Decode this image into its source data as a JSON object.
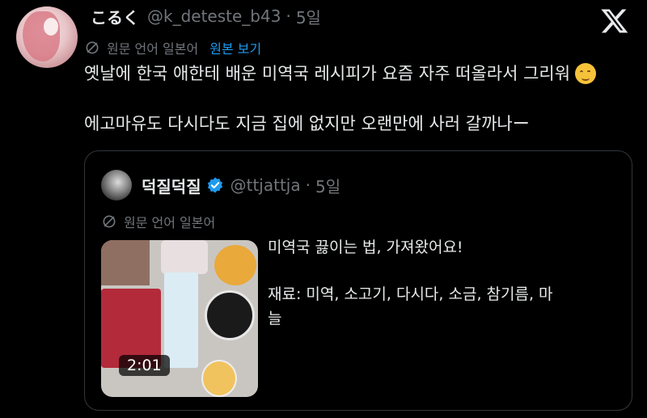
{
  "tweet": {
    "display_name": "こるく",
    "handle": "@k_deteste_b43",
    "separator": "·",
    "time": "5일",
    "original_language_note": "원문 언어 일본어",
    "show_original_label": "원본 보기",
    "lines": [
      "옛날에 한국 애한테 배운 미역국 레시피가 요즘 자주 떠올라서 그리워",
      "에고마유도 다시다도 지금 집에 없지만 오랜만에 사러 갈까나ー"
    ],
    "emoji_icon": "relieved-face-emoji"
  },
  "quoted_tweet": {
    "display_name": "덕질덕질",
    "handle": "@ttjattja",
    "separator": "·",
    "time": "5일",
    "verified": true,
    "original_language_note": "원문 언어 일본어",
    "media": {
      "type": "video",
      "duration": "2:01"
    },
    "lines": [
      "미역국 끓이는 법, 가져왔어요!",
      "재료: 미역, 소고기, 다시다, 소금, 참기름, 마",
      "늘"
    ]
  },
  "colors": {
    "background": "#000000",
    "text": "#e7e9ea",
    "muted": "#71767b",
    "accent": "#1d9bf0",
    "border": "#333639"
  },
  "icons": {
    "brand": "x-logo-icon",
    "translate": "translate-icon",
    "verified": "verified-badge-icon"
  }
}
